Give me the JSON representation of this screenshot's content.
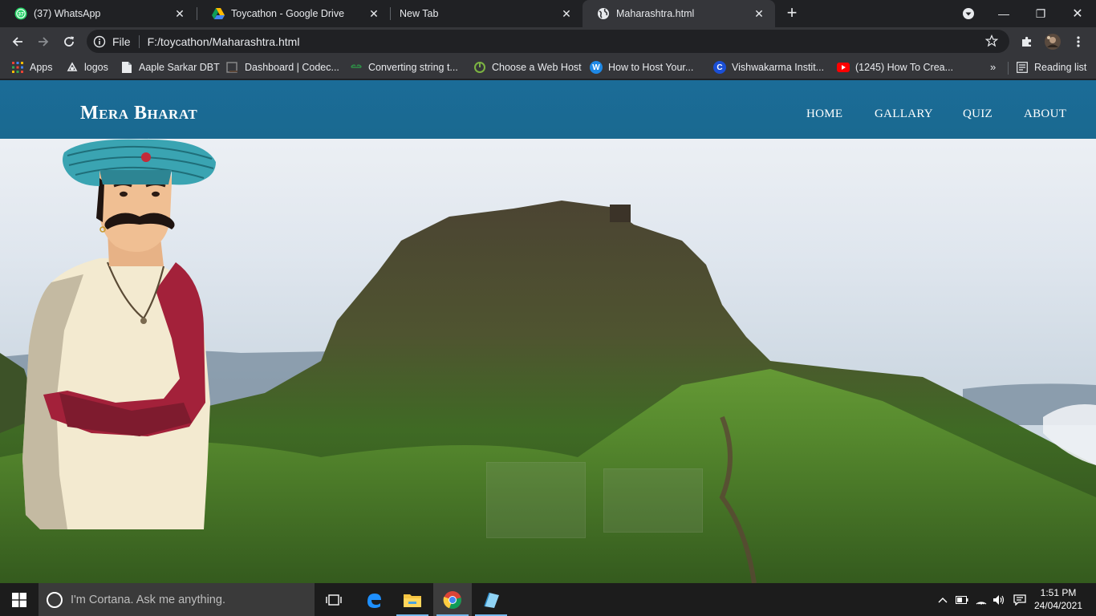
{
  "browser": {
    "tabs": [
      {
        "title": "(37) WhatsApp",
        "badge": "37",
        "icon": "whatsapp-icon",
        "active": false
      },
      {
        "title": "Toycathon - Google Drive",
        "icon": "google-drive-icon",
        "active": false
      },
      {
        "title": "New Tab",
        "icon": "none",
        "active": false
      },
      {
        "title": "Maharashtra.html",
        "icon": "globe-icon",
        "active": true
      }
    ],
    "close_glyph": "✕",
    "new_tab_glyph": "+",
    "window_controls": {
      "minimize": "—",
      "maximize": "❐",
      "close": "✕"
    },
    "address": {
      "scheme_label": "File",
      "url": "F:/toycathon/Maharashtra.html"
    },
    "bookmarks": [
      {
        "label": "Apps",
        "icon": "apps-grid-icon"
      },
      {
        "label": "logos",
        "icon": "logos-icon"
      },
      {
        "label": "Aaple Sarkar DBT",
        "icon": "page-icon"
      },
      {
        "label": "Dashboard | Codec...",
        "icon": "codechef-icon"
      },
      {
        "label": "Converting string t...",
        "icon": "gfg-icon"
      },
      {
        "label": "Choose a Web Host",
        "icon": "webhost-icon"
      },
      {
        "label": "How to Host Your...",
        "icon": "w-icon",
        "glyph": "W"
      },
      {
        "label": "Vishwakarma Instit...",
        "icon": "c-icon",
        "glyph": "C"
      },
      {
        "label": "(1245) How To Crea...",
        "icon": "youtube-icon"
      }
    ],
    "bookmarks_overflow": "»",
    "reading_list": "Reading list"
  },
  "website": {
    "brand": "Mera Bharat",
    "nav": [
      "HOME",
      "GALLARY",
      "QUIZ",
      "ABOUT"
    ]
  },
  "taskbar": {
    "search_placeholder": "I'm Cortana. Ask me anything.",
    "apps": [
      "task-view-icon",
      "edge-icon",
      "file-explorer-icon",
      "chrome-icon",
      "notepad-icon"
    ],
    "time": "1:51 PM",
    "date": "24/04/2021"
  },
  "colors": {
    "site_nav": "#1b6c98",
    "chrome_dark": "#202124",
    "chrome_toolbar": "#35363a",
    "taskbar": "#1c1c1c"
  }
}
